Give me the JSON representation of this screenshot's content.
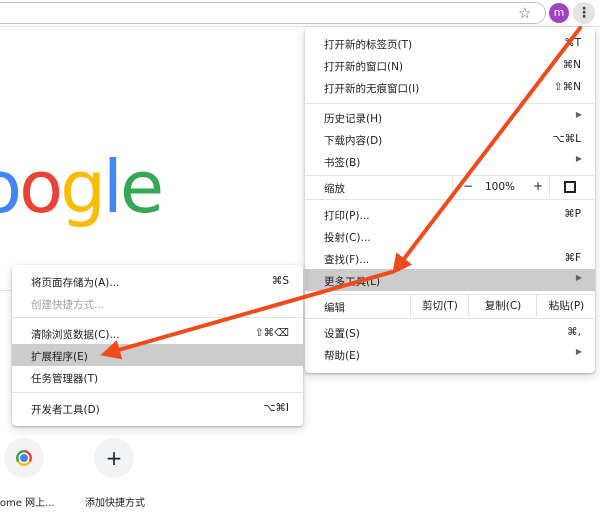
{
  "toolbar": {
    "avatar_letter": "m",
    "star_icon": "bookmark-star-icon",
    "menu_icon": "kebab-menu-icon"
  },
  "logo": {
    "letters": [
      "o",
      "o",
      "g",
      "l",
      "e"
    ],
    "colors": {
      "blue": "#4285f4",
      "red": "#ea4335",
      "yellow": "#fbbc05",
      "green": "#34a853"
    }
  },
  "shortcuts": [
    {
      "label": "rome 网上...",
      "icon": "chrome-icon"
    },
    {
      "label": "添加快捷方式",
      "icon": "plus-icon"
    }
  ],
  "main_menu": {
    "new_tab": {
      "label": "打开新的标签页(T)",
      "shortcut": "⌘T"
    },
    "new_window": {
      "label": "打开新的窗口(N)",
      "shortcut": "⌘N"
    },
    "new_incognito": {
      "label": "打开新的无痕窗口(I)",
      "shortcut": "⇧⌘N"
    },
    "history": {
      "label": "历史记录(H)"
    },
    "downloads": {
      "label": "下载内容(D)",
      "shortcut": "⌥⌘L"
    },
    "bookmarks": {
      "label": "书签(B)"
    },
    "zoom": {
      "label": "缩放",
      "minus": "−",
      "value": "100%",
      "plus": "+"
    },
    "print": {
      "label": "打印(P)...",
      "shortcut": "⌘P"
    },
    "cast": {
      "label": "投射(C)..."
    },
    "find": {
      "label": "查找(F)...",
      "shortcut": "⌘F"
    },
    "more_tools": {
      "label": "更多工具(L)"
    },
    "edit": {
      "label": "编辑",
      "cut": "剪切(T)",
      "copy": "复制(C)",
      "paste": "粘贴(P)"
    },
    "settings": {
      "label": "设置(S)",
      "shortcut": "⌘,"
    },
    "help": {
      "label": "帮助(E)"
    },
    "submenu_arrow": "▶"
  },
  "sub_menu": {
    "save_page": {
      "label": "将页面存储为(A)...",
      "shortcut": "⌘S"
    },
    "create_shortcut": {
      "label": "创建快捷方式..."
    },
    "clear_data": {
      "label": "清除浏览数据(C)...",
      "shortcut": "⇧⌘⌫"
    },
    "extensions": {
      "label": "扩展程序(E)"
    },
    "task_manager": {
      "label": "任务管理器(T)"
    },
    "dev_tools": {
      "label": "开发者工具(D)",
      "shortcut": "⌥⌘I"
    }
  },
  "colors": {
    "highlight": "#cccccc",
    "annotation_arrow": "#f04a1d",
    "avatar": "#a142c6"
  }
}
